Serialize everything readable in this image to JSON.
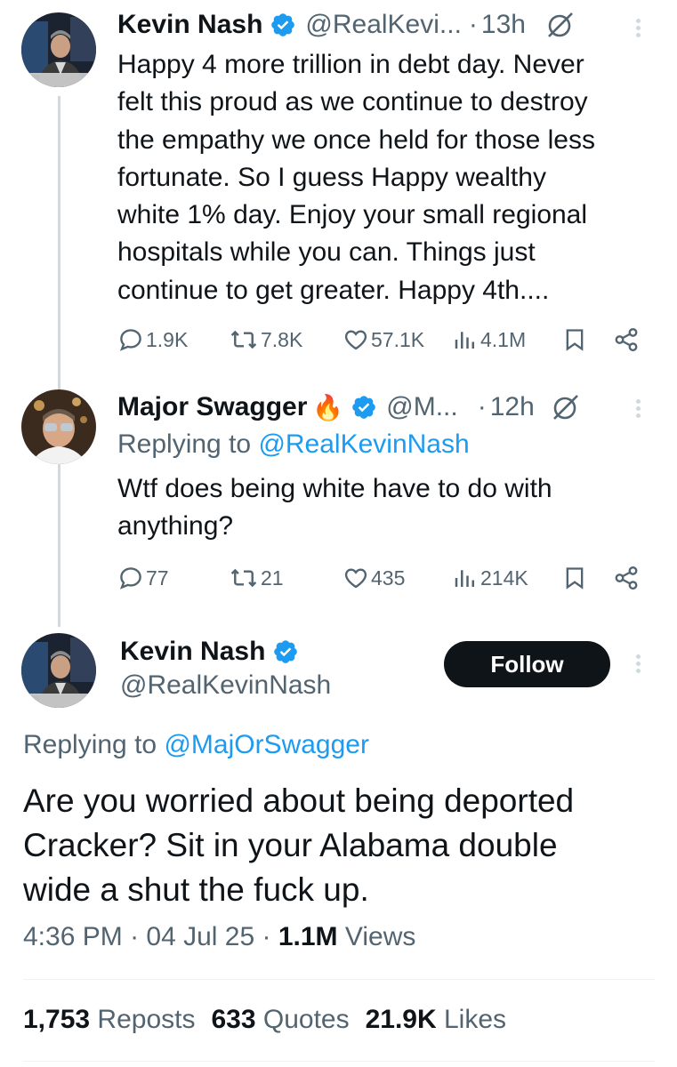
{
  "tweet1": {
    "name": "Kevin Nash",
    "handle": "@RealKevi...",
    "dot": "·",
    "time": "13h",
    "lines": [
      "Happy 4 more trillion in debt day. Never",
      "felt this proud as we continue to destroy",
      "the empathy we once held for those less",
      "fortunate. So I guess Happy wealthy",
      "white 1% day. Enjoy your small regional",
      "hospitals while you can. Things just",
      "continue to get greater.  Happy 4th...."
    ],
    "replies": "1.9K",
    "reposts": "7.8K",
    "likes": "57.1K",
    "views": "4.1M"
  },
  "tweet2": {
    "name": "Major Swagger",
    "emoji": "🔥",
    "handle": "@M...",
    "dot": "·",
    "time": "12h",
    "replying_prefix": "Replying to ",
    "replying_handle": "@RealKevinNash",
    "lines": [
      "Wtf does being white have to do with",
      "anything?"
    ],
    "replies": "77",
    "reposts": "21",
    "likes": "435",
    "views": "214K"
  },
  "main_tweet": {
    "name": "Kevin Nash",
    "handle": "@RealKevinNash",
    "follow_label": "Follow",
    "replying_prefix": "Replying to ",
    "replying_handle": "@MajOrSwagger",
    "lines": [
      "Are you worried about being deported",
      "Cracker? Sit in your Alabama double",
      "wide a shut the fuck up."
    ],
    "time": "4:36 PM",
    "sep1": " · ",
    "date": "04 Jul 25",
    "sep2": " · ",
    "views_count": "1.1M",
    "views_label": " Views",
    "reposts_count": "1,753",
    "reposts_label": " Reposts",
    "quotes_count": "633",
    "quotes_label": " Quotes",
    "likes_count": "21.9K",
    "likes_label": " Likes"
  },
  "icons": {
    "verified": "verified-badge-icon",
    "grok": "grok-icon",
    "more": "more-vertical-icon",
    "reply": "reply-icon",
    "repost": "repost-icon",
    "like": "heart-icon",
    "views": "views-icon",
    "bookmark": "bookmark-icon",
    "share": "share-icon"
  },
  "colors": {
    "text": "#0f1419",
    "secondary": "#536471",
    "link": "#1d9bf0",
    "verified": "#1d9bf0",
    "follow_bg": "#0f1419"
  }
}
